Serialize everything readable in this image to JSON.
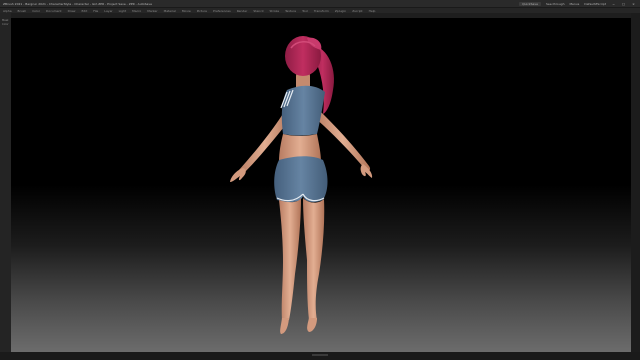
{
  "window": {
    "title": "ZBrush 2021 - Bergrun 2021 - CharacterStyle - Character - Girl.ZPR - Project Save - ZPR - AutoSave",
    "quicksave_label": "QuickSave",
    "user_label": "See-through",
    "menus_label": "Menus",
    "script_label": "DefaultZScript"
  },
  "menubar": {
    "items": [
      "Alpha",
      "Brush",
      "Color",
      "Document",
      "Draw",
      "Edit",
      "File",
      "Layer",
      "Light",
      "Macro",
      "Marker",
      "Material",
      "Movie",
      "Picture",
      "Preferences",
      "Render",
      "Stencil",
      "Stroke",
      "Texture",
      "Tool",
      "Transform",
      "Zplugin",
      "Zscript",
      "Help"
    ]
  },
  "left_panel": {
    "labels": [
      "Mask",
      "Color"
    ]
  },
  "viewport": {
    "subject": "3D character model - girl in t-shirt and shorts, rear view"
  },
  "colors": {
    "background_top": "#000000",
    "background_bottom": "#6c6c6c",
    "hair": "#b8285a",
    "skin": "#dca58a",
    "clothing": "#5e7c9c"
  }
}
